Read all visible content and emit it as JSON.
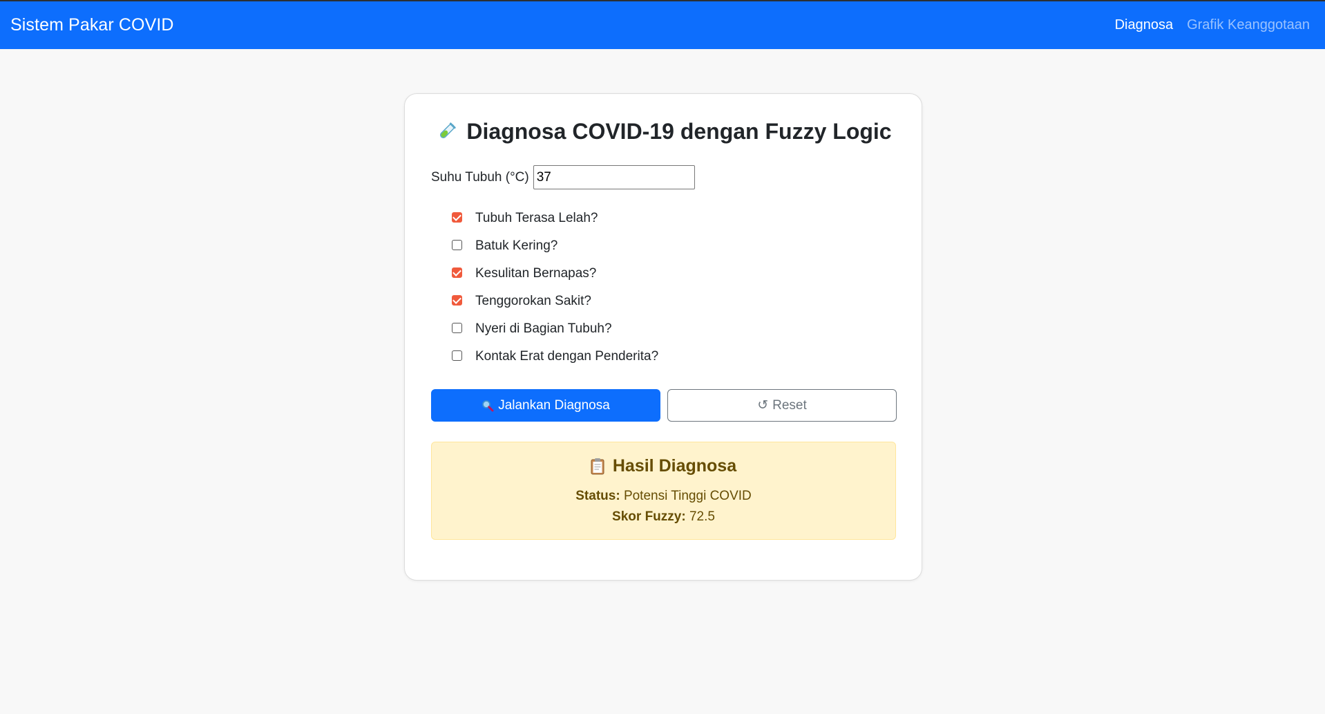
{
  "navbar": {
    "brand": "Sistem Pakar COVID",
    "links": [
      {
        "label": "Diagnosa",
        "active": true
      },
      {
        "label": "Grafik Keanggotaan",
        "active": false
      }
    ],
    "color": "#0d6efd"
  },
  "form": {
    "title": "Diagnosa COVID-19 dengan Fuzzy Logic",
    "title_icon": "test-tube-icon",
    "temperature": {
      "label": "Suhu Tubuh (°C)",
      "value": "37"
    },
    "symptoms": [
      {
        "label": "Tubuh Terasa Lelah?",
        "checked": true
      },
      {
        "label": "Batuk Kering?",
        "checked": false
      },
      {
        "label": "Kesulitan Bernapas?",
        "checked": true
      },
      {
        "label": "Tenggorokan Sakit?",
        "checked": true
      },
      {
        "label": "Nyeri di Bagian Tubuh?",
        "checked": false
      },
      {
        "label": "Kontak Erat dengan Penderita?",
        "checked": false
      }
    ],
    "buttons": {
      "run_label": "Jalankan Diagnosa",
      "run_icon": "magnifier-icon",
      "reset_label": "Reset",
      "reset_icon": "↺"
    }
  },
  "result": {
    "title": "Hasil Diagnosa",
    "title_icon": "clipboard-icon",
    "status_key": "Status:",
    "status_value": "Potensi Tinggi COVID",
    "score_key": "Skor Fuzzy:",
    "score_value": "72.5",
    "color": "#fff3cd"
  },
  "colors": {
    "accent": "#0d6efd",
    "checkbox_checked": "#f05a3c",
    "background": "#f8f8f8"
  }
}
